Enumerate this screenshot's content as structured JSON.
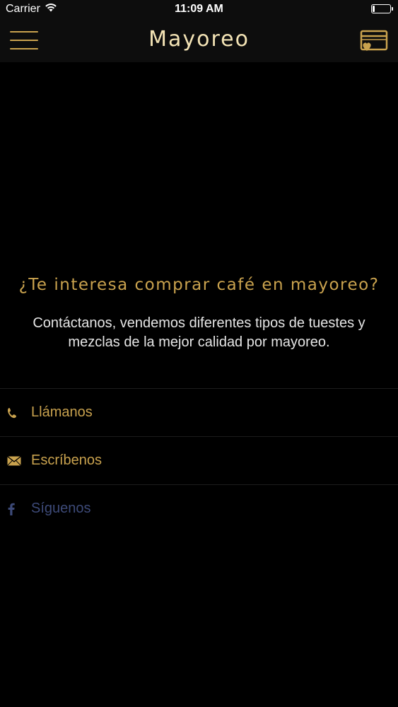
{
  "status_bar": {
    "carrier": "Carrier",
    "time": "11:09 AM",
    "battery_level": 0.15,
    "icons": [
      "wifi-icon",
      "battery-icon"
    ]
  },
  "nav": {
    "title": "Mayoreo",
    "menu_icon": "hamburger-menu-icon",
    "card_icon": "loyalty-card-icon"
  },
  "main": {
    "headline": "¿Te interesa comprar café en mayoreo?",
    "description": "Contáctanos, vendemos diferentes tipos de tuestes y mezclas de la mejor calidad por mayoreo."
  },
  "contacts": [
    {
      "label": "Llámanos",
      "icon": "phone-icon"
    },
    {
      "label": "Escríbenos",
      "icon": "envelope-icon"
    },
    {
      "label": "Síguenos",
      "icon": "facebook-icon"
    }
  ],
  "colors": {
    "background": "#000000",
    "bar_background": "#0d0d0d",
    "accent_gold": "#c9a24e",
    "title_cream": "#f3e3b5",
    "text_light": "#e6e6e6",
    "facebook_blue": "#3d4a78",
    "divider": "#1c1c1c"
  }
}
